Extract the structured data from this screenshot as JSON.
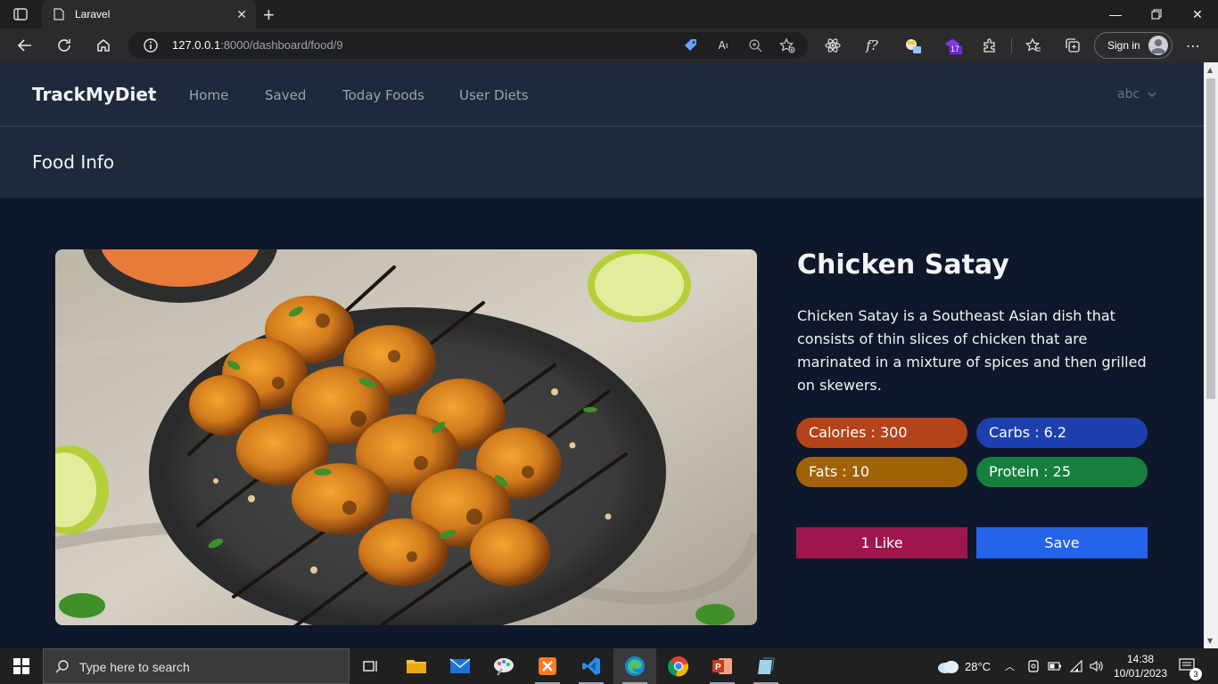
{
  "browser": {
    "tab_title": "Laravel",
    "url_host": "127.0.0.1",
    "url_rest": ":8000/dashboard/food/9",
    "signin_label": "Sign in",
    "extension_badge": "17",
    "icons": [
      "tab-actions-icon",
      "back-icon",
      "refresh-icon",
      "home-icon",
      "site-info-icon",
      "tag-icon",
      "read-aloud-icon",
      "zoom-icon",
      "add-favorite-icon",
      "react-devtools-icon",
      "formula-icon",
      "extension-icon",
      "extension-badge-icon",
      "extensions-icon",
      "favorites-icon",
      "collections-icon",
      "more-icon"
    ]
  },
  "nav": {
    "brand": "TrackMyDiet",
    "links": [
      "Home",
      "Saved",
      "Today Foods",
      "User Diets"
    ],
    "user": "abc"
  },
  "header": {
    "title": "Food Info"
  },
  "food": {
    "name": "Chicken Satay",
    "description": "Chicken Satay is a Southeast Asian dish that consists of thin slices of chicken that are marinated in a mixture of spices and then grilled on skewers.",
    "calories": "Calories : 300",
    "carbs": "Carbs : 6.2",
    "fats": "Fats : 10",
    "protein": "Protein : 25",
    "like_label": "1 Like",
    "save_label": "Save"
  },
  "colors": {
    "calories": "#b4431a",
    "carbs": "#1e40af",
    "fats": "#a16207",
    "protein": "#15803d",
    "like": "#9d174d",
    "save": "#2563eb"
  },
  "taskbar": {
    "search_placeholder": "Type here to search",
    "weather": "28°C",
    "time": "14:38",
    "date": "10/01/2023",
    "notification_count": "3"
  }
}
